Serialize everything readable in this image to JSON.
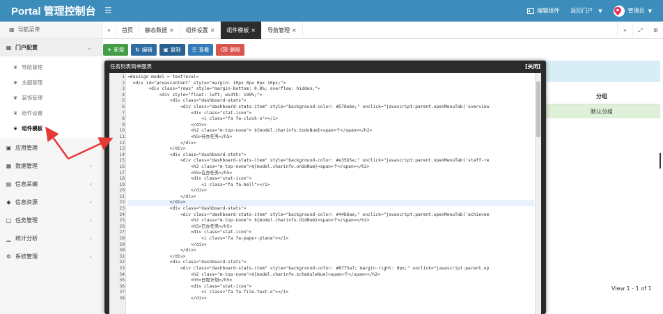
{
  "header": {
    "brand": "Portal 管理控制台",
    "edit_component": "编辑组件",
    "back_portal": "返回门户",
    "admin": "管理员"
  },
  "sidebar": {
    "title": "导航菜单",
    "portal_group": "门户配置",
    "portal_items": [
      "导航管理",
      "主题管理",
      "装饰管理",
      "组件设置",
      "组件模板"
    ],
    "groups": [
      "应用管理",
      "数据管理",
      "信息采编",
      "信息资源",
      "任务管理",
      "统计分析",
      "系统管理"
    ]
  },
  "tabs": [
    "首页",
    "静态数据",
    "组件设置",
    "组件模板",
    "导航管理"
  ],
  "toolbar": {
    "add": "新增",
    "edit": "编辑",
    "copy": "复制",
    "view": "查看",
    "delete": "删除"
  },
  "table": {
    "header": "分组",
    "row": "默认分组",
    "pager": "View 1 - 1 of 1"
  },
  "modal": {
    "title": "任务列表简单图表",
    "close": "[关闭]",
    "lines": [
      "<#assign model = text?eval>",
      "  <div id=\"areascontent\" style=\"margin: 10px 0px 0px 10px;\">",
      "        <div class=\"rows\" style=\"margin-bottom: 0.8%; overflow: hidden;\">",
      "            <div style=\"float: left; width: 100%;\">",
      "                <div class=\"dashboard-stats\">",
      "                    <div class=\"dashboard-stats-item\" style=\"background-color: #578ebe;\" onclick=\"javascript:parent.openMenuTab('overview",
      "                        <div class=\"stat-icon\">",
      "                            <i class=\"fa fa-clock-o\"></i>",
      "                        </div>",
      "                        <h2 class=\"m-top-none\"> ${model.charinfo.todoNum}<span>个</span></h2>",
      "                        <h5>待办任务</h5>",
      "                    </div>",
      "                </div>",
      "                <div class=\"dashboard-stats\">",
      "                    <div class=\"dashboard-stats-item\" style=\"background-color: #e35b5a;\" onclick=\"javascript:parent.openMenuTab('staff-re",
      "                        <h2 class=\"m-top-none\">${model.charinfo.ondoNum}<span>个</span></h2>",
      "                        <h5>在办任务</h5>",
      "                        <div class=\"stat-icon\">",
      "                            <i class=\"fa fa-bell\"></i>",
      "                        </div>",
      "                    </div>",
      "                </div>",
      "                <div class=\"dashboard-stats\">",
      "                    <div class=\"dashboard-stats-item\" style=\"background-color: #44b6ae;\" onclick=\"javascript:parent.openMenuTab('achievem",
      "                        <h2 class=\"m-top-none\"> ${model.charinfo.didNum}<span>个</span></h2>",
      "                        <h5>已办任务</h5>",
      "                        <div class=\"stat-icon\">",
      "                            <i class=\"fa fa-paper-plane\"></i>",
      "                        </div>",
      "                    </div>",
      "                </div>",
      "                <div class=\"dashboard-stats\">",
      "                    <div class=\"dashboard-stats-item\" style=\"background-color: #8775a7; margin-right: 0px;\" onclick=\"javascript:parent.op",
      "                        <h2 class=\"m-top-none\">${model.charinfo.scheduleNum}<span>个</span></h2>",
      "                        <h5>日程计划</h5>",
      "                        <div class=\"stat-icon\">",
      "                            <i class=\"fa fa-file-text-o\"></i>",
      "                        </div>"
    ]
  }
}
